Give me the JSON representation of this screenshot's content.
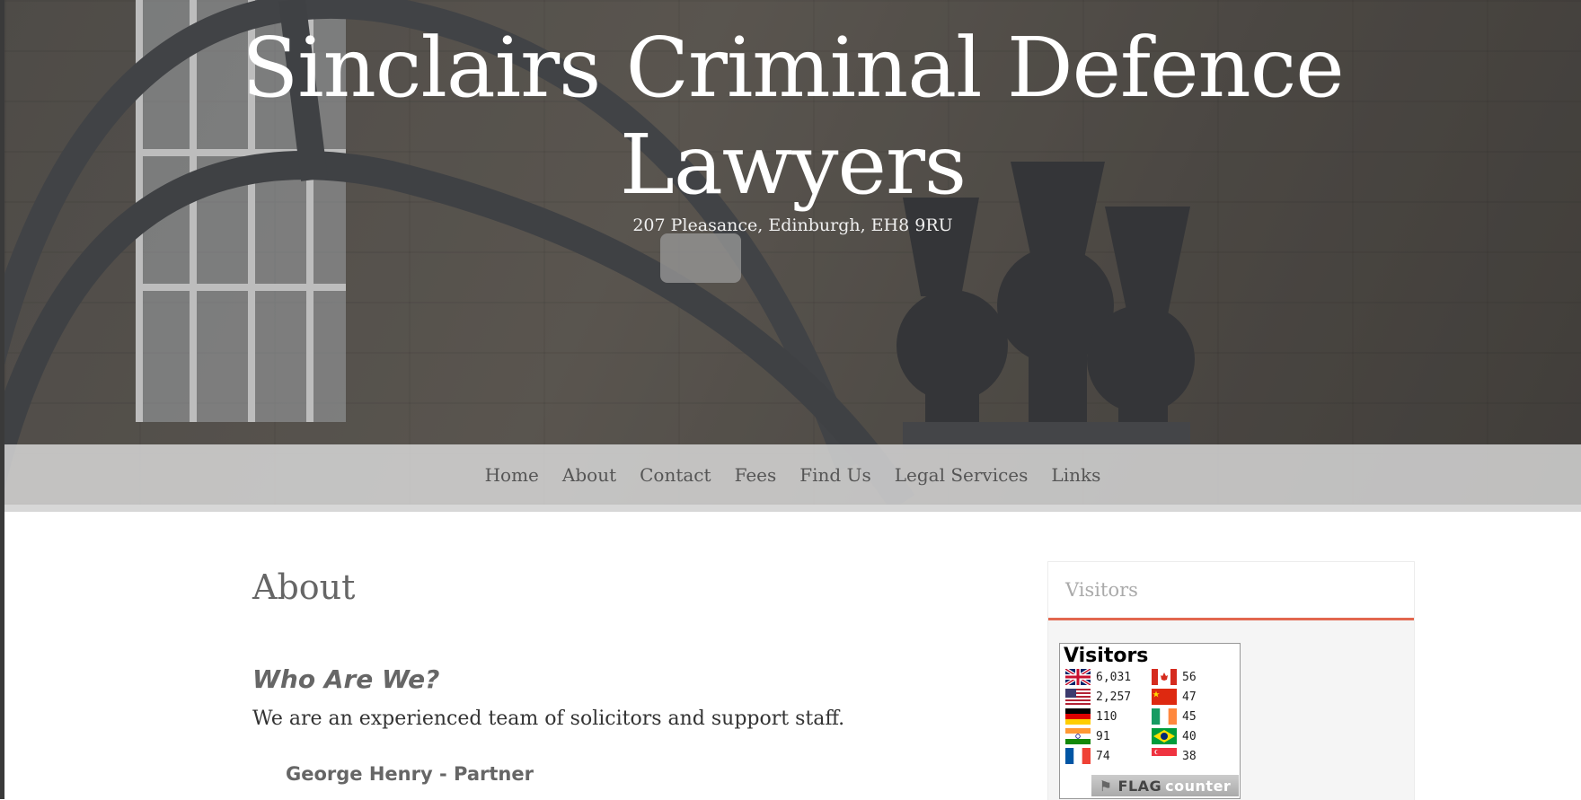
{
  "header": {
    "title_line1": "Sinclairs Criminal Defence",
    "title_line2": "Lawyers",
    "address": "207 Pleasance, Edinburgh, EH8 9RU"
  },
  "nav": {
    "items": [
      "Home",
      "About",
      "Contact",
      "Fees",
      "Find Us",
      "Legal Services",
      "Links"
    ]
  },
  "main": {
    "page_title": "About",
    "section_heading": "Who Are We?",
    "intro": "We are an experienced team of solicitors and support staff.",
    "staff": [
      "George Henry - Partner"
    ]
  },
  "sidebar": {
    "widget_title": "Visitors",
    "flag_counter": {
      "title": "Visitors",
      "brand_flag": "FLAG",
      "brand_counter": "counter",
      "left_column": [
        {
          "country": "gb-flag-icon",
          "count": "6,031"
        },
        {
          "country": "us-flag-icon",
          "count": "2,257"
        },
        {
          "country": "de-flag-icon",
          "count": "110"
        },
        {
          "country": "in-flag-icon",
          "count": "91"
        },
        {
          "country": "fr-flag-icon",
          "count": "74"
        }
      ],
      "right_column": [
        {
          "country": "ca-flag-icon",
          "count": "56"
        },
        {
          "country": "cn-flag-icon",
          "count": "47"
        },
        {
          "country": "ie-flag-icon",
          "count": "45"
        },
        {
          "country": "br-flag-icon",
          "count": "40"
        },
        {
          "country": "sg-flag-icon",
          "count": "38"
        }
      ]
    }
  },
  "colors": {
    "accent": "#e2674f",
    "nav_text": "#555555",
    "heading_text": "#666666"
  }
}
